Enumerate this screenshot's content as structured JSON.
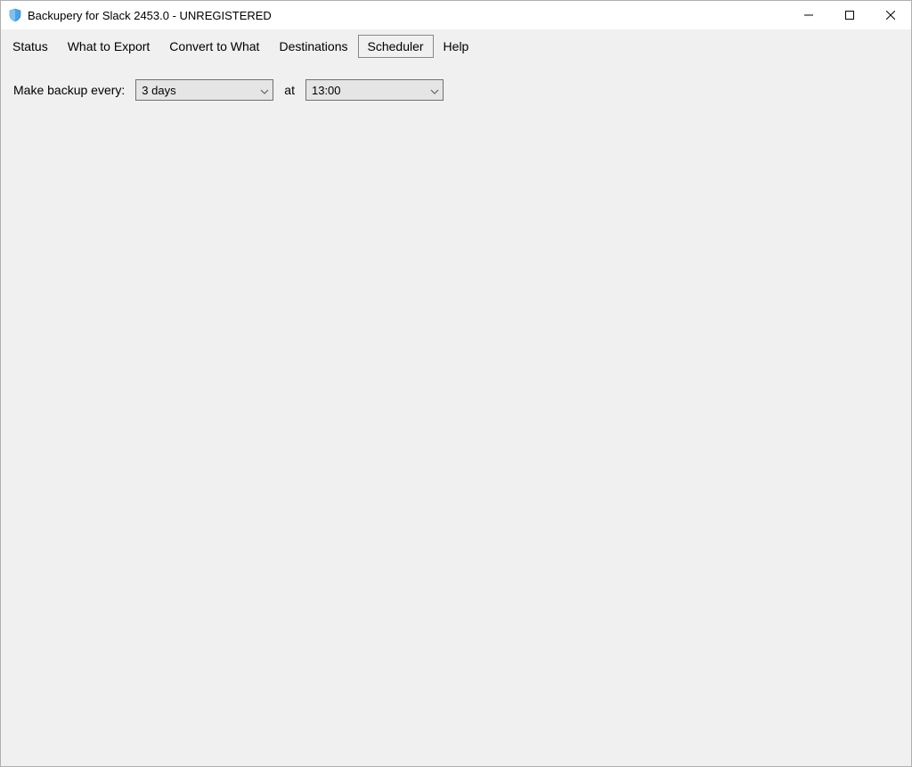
{
  "window": {
    "title": "Backupery for Slack 2453.0 - UNREGISTERED"
  },
  "tabs": {
    "items": [
      {
        "label": "Status"
      },
      {
        "label": "What to Export"
      },
      {
        "label": "Convert to What"
      },
      {
        "label": "Destinations"
      },
      {
        "label": "Scheduler"
      },
      {
        "label": "Help"
      }
    ],
    "activeIndex": 4
  },
  "scheduler": {
    "label_every": "Make backup every:",
    "interval_value": "3 days",
    "label_at": "at",
    "time_value": "13:00"
  },
  "icons": {
    "shield": "shield-icon",
    "minimize": "minimize-icon",
    "maximize": "maximize-icon",
    "close": "close-icon",
    "dropdown": "chevron-down-icon"
  }
}
